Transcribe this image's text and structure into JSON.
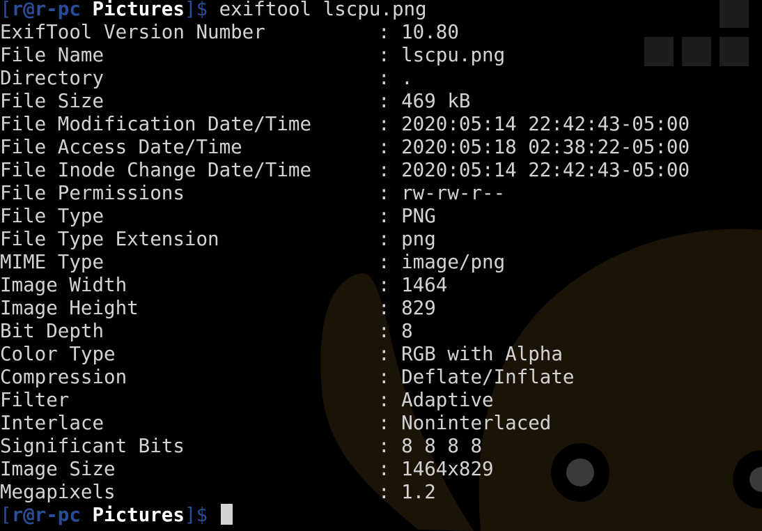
{
  "prompt": {
    "open_bracket": "[",
    "userhost": "r@r-pc",
    "space": " ",
    "cwd": "Pictures",
    "close_bracket": "]",
    "dollar": "$",
    "command": " exiftool lscpu.png"
  },
  "separator": ": ",
  "rows": [
    {
      "key": "ExifTool Version Number",
      "value": "10.80"
    },
    {
      "key": "File Name",
      "value": "lscpu.png"
    },
    {
      "key": "Directory",
      "value": "."
    },
    {
      "key": "File Size",
      "value": "469 kB"
    },
    {
      "key": "File Modification Date/Time",
      "value": "2020:05:14 22:42:43-05:00"
    },
    {
      "key": "File Access Date/Time",
      "value": "2020:05:18 02:38:22-05:00"
    },
    {
      "key": "File Inode Change Date/Time",
      "value": "2020:05:14 22:42:43-05:00"
    },
    {
      "key": "File Permissions",
      "value": "rw-rw-r--"
    },
    {
      "key": "File Type",
      "value": "PNG"
    },
    {
      "key": "File Type Extension",
      "value": "png"
    },
    {
      "key": "MIME Type",
      "value": "image/png"
    },
    {
      "key": "Image Width",
      "value": "1464"
    },
    {
      "key": "Image Height",
      "value": "829"
    },
    {
      "key": "Bit Depth",
      "value": "8"
    },
    {
      "key": "Color Type",
      "value": "RGB with Alpha"
    },
    {
      "key": "Compression",
      "value": "Deflate/Inflate"
    },
    {
      "key": "Filter",
      "value": "Adaptive"
    },
    {
      "key": "Interlace",
      "value": "Noninterlaced"
    },
    {
      "key": "Significant Bits",
      "value": "8 8 8 8"
    },
    {
      "key": "Image Size",
      "value": "1464x829"
    },
    {
      "key": "Megapixels",
      "value": "1.2"
    }
  ],
  "colors": {
    "background": "#000000",
    "text": "#d3d3d3",
    "prompt_accent": "#2a4d9a",
    "cwd": "#ffffff",
    "wallpaper_mascot": "#1c1307"
  }
}
